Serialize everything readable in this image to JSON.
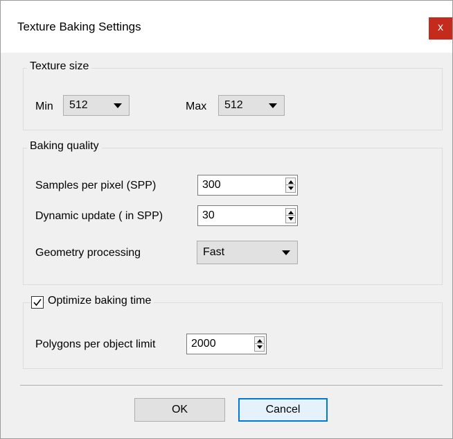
{
  "window": {
    "title": "Texture Baking Settings",
    "close_glyph": "x"
  },
  "texture_size": {
    "legend": "Texture size",
    "min_label": "Min",
    "min_value": "512",
    "max_label": "Max",
    "max_value": "512"
  },
  "baking_quality": {
    "legend": "Baking quality",
    "spp_label": "Samples per pixel (SPP)",
    "spp_value": "300",
    "dynamic_label": "Dynamic update ( in SPP)",
    "dynamic_value": "30",
    "geometry_label": "Geometry processing",
    "geometry_value": "Fast"
  },
  "optimize": {
    "checkbox_label": "Optimize baking time",
    "checked": true,
    "polygons_label": "Polygons per object limit",
    "polygons_value": "2000"
  },
  "buttons": {
    "ok": "OK",
    "cancel": "Cancel"
  },
  "colors": {
    "close_bg": "#c42b1c",
    "default_button_border": "#0078d7",
    "dialog_bg": "#f0f0f0"
  }
}
